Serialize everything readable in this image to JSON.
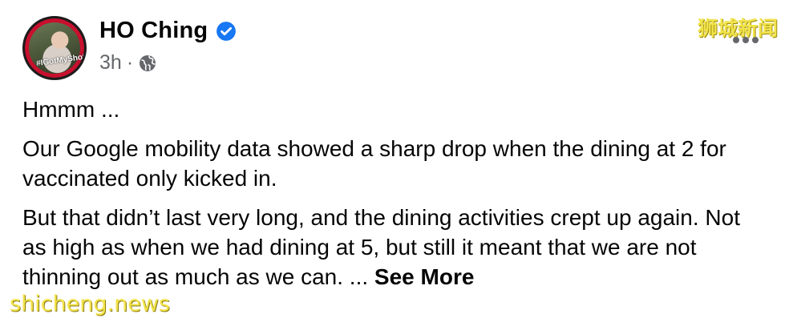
{
  "post": {
    "author_name": "HO Ching",
    "timestamp": "3h",
    "separator": "·",
    "privacy_icon": "globe-icon",
    "verified_icon": "verified-badge-icon",
    "avatar_badge_text": "#IGotMyShot",
    "paragraphs": [
      "Hmmm ...",
      "Our Google mobility data showed a sharp drop when the dining at 2 for vaccinated only kicked in.",
      "But that didn’t last very long, and the dining activities crept up again. Not as high as when we had dining at 5, but still it meant that we are not thinning out as much as we can. ..."
    ],
    "see_more_label": "See More"
  },
  "watermarks": {
    "top_right": "狮城新闻",
    "bottom_left": "shicheng.news"
  },
  "colors": {
    "verified_blue": "#1877f2",
    "meta_gray": "#65676b",
    "watermark_yellow": "#f2e34a"
  }
}
